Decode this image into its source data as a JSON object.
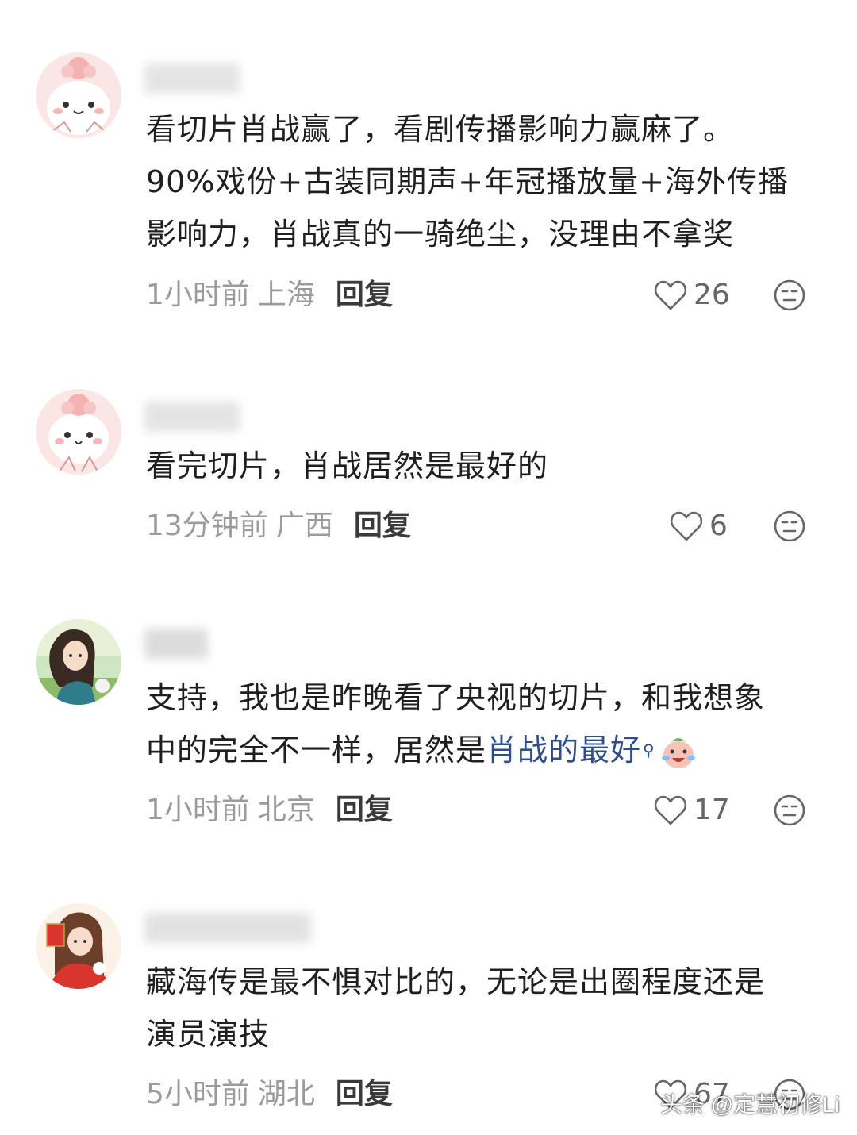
{
  "comments": [
    {
      "text_lines": [
        "看切片肖战赢了，看剧传播影响力赢麻了。",
        "90%戏份+古装同期声+年冠播放量+海外传播",
        "影响力，肖战真的一骑绝尘，没理由不拿奖"
      ],
      "time": "1小时前",
      "location": "上海",
      "reply_label": "回复",
      "likes": "26",
      "avatar": "pink-bunny-avatar"
    },
    {
      "text_lines": [
        "看完切片，肖战居然是最好的"
      ],
      "time": "13分钟前",
      "location": "广西",
      "reply_label": "回复",
      "likes": "6",
      "avatar": "pink-bunny-avatar"
    },
    {
      "text_prefix_line1": "支持，我也是昨晚看了央视的切片，和我想象",
      "text_prefix_line2": "中的完全不一样，居然是",
      "link_text": "肖战的最好",
      "time": "1小时前",
      "location": "北京",
      "reply_label": "回复",
      "likes": "17",
      "avatar": "anime-girl-avatar"
    },
    {
      "text_lines": [
        "藏海传是最不惧对比的，无论是出圈程度还是",
        "演员演技"
      ],
      "time": "5小时前",
      "location": "湖北",
      "reply_label": "回复",
      "likes": "67",
      "avatar": "new-year-girl-avatar"
    }
  ],
  "watermark": "头条 @定慧初修Li",
  "colors": {
    "link": "#2f4d8a",
    "meta": "#9b9b9b",
    "text": "#1f1f1f"
  }
}
